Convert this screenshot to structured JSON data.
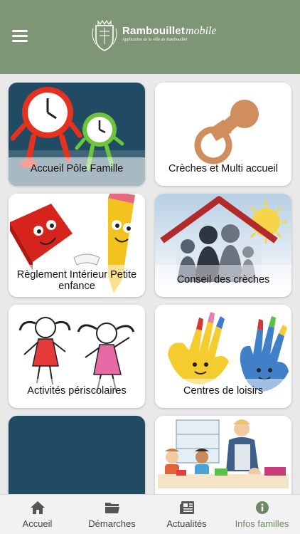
{
  "header": {
    "brand": "Rambouillet",
    "brand_suffix": "mobile",
    "tagline": "Application de la ville de Rambouillet"
  },
  "tiles": [
    {
      "label": "Accueil Pôle Famille"
    },
    {
      "label": "Crèches et Multi accueil"
    },
    {
      "label": "Règlement Intérieur Petite enfance"
    },
    {
      "label": "Conseil des crèches"
    },
    {
      "label": "Activités périscolaires"
    },
    {
      "label": "Centres de loisirs"
    }
  ],
  "tabs": [
    {
      "label": "Accueil",
      "icon": "home-icon"
    },
    {
      "label": "Démarches",
      "icon": "folder-icon"
    },
    {
      "label": "Actualités",
      "icon": "newspaper-icon"
    },
    {
      "label": "Infos familles",
      "icon": "info-icon",
      "active": true
    }
  ],
  "colors": {
    "header": "#7f9676",
    "active_tab": "#6e8a64",
    "tile_dark": "#214a63"
  }
}
